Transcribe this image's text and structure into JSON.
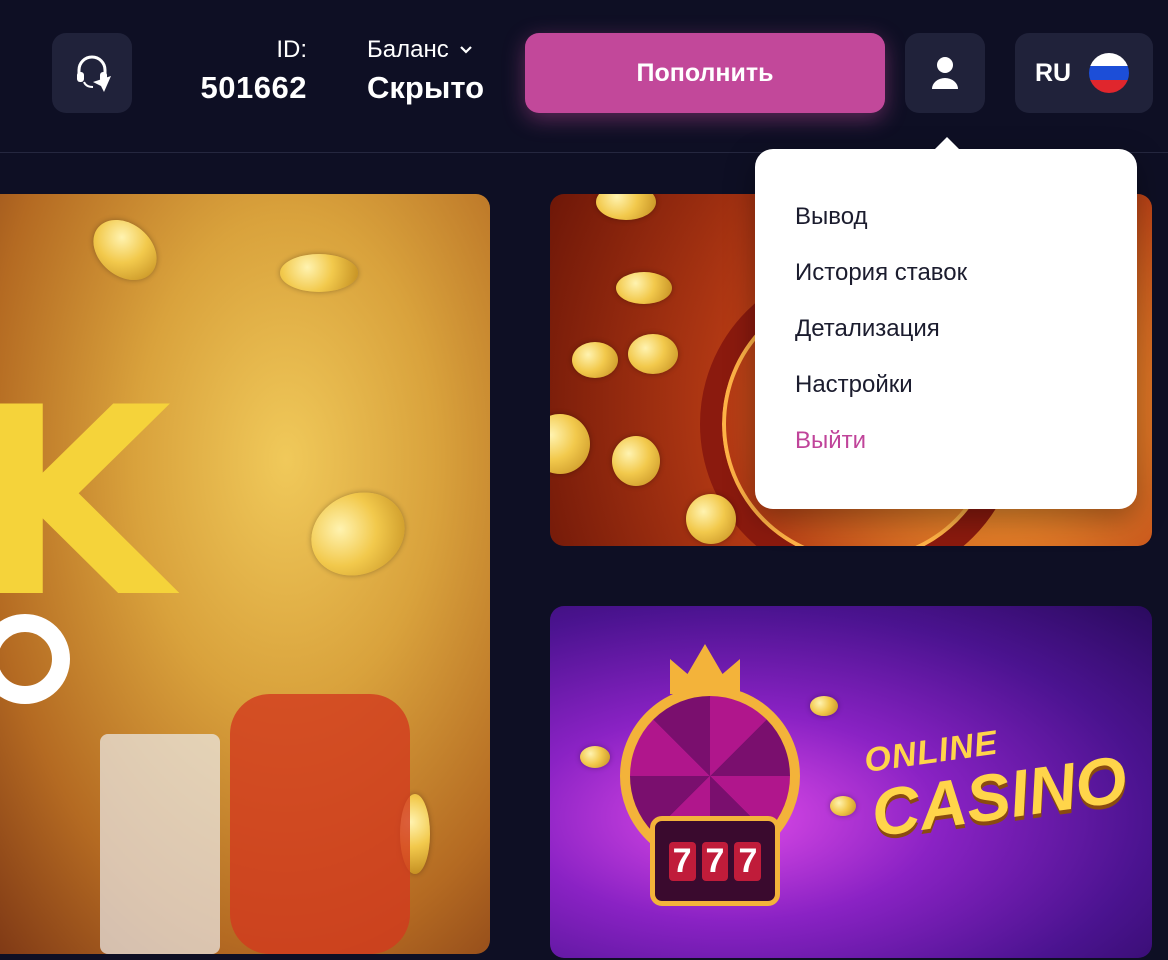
{
  "header": {
    "support_icon": "headset-telegram-icon",
    "id_label": "ID:",
    "id_value": "501662",
    "balance_label": "Баланс",
    "balance_value": "Скрыто",
    "balance_chevron_icon": "chevron-down-icon",
    "deposit_label": "Пополнить",
    "profile_icon": "user-icon",
    "language_code": "RU",
    "flag_icon": "russia-flag-icon"
  },
  "user_menu": {
    "items": [
      {
        "label": "Вывод"
      },
      {
        "label": "История ставок"
      },
      {
        "label": "Детализация"
      },
      {
        "label": "Настройки"
      }
    ],
    "logout_label": "Выйти"
  },
  "banners": {
    "right_bottom": {
      "line1": "ONLINE",
      "line2": "CASINO",
      "slot_symbols": [
        "7",
        "7",
        "7"
      ]
    }
  },
  "colors": {
    "background": "#0e0f24",
    "surface": "#20223a",
    "accent": "#c2489a",
    "menu_text": "#1b1c2e"
  }
}
